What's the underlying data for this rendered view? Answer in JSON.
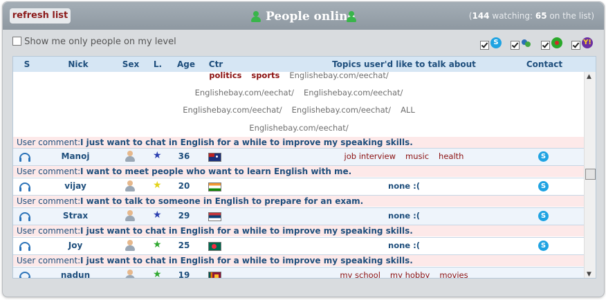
{
  "header": {
    "refresh_label": "refresh list",
    "title": "People online",
    "watching_open": "(",
    "watching_count": "144",
    "watching_label": "watching:",
    "on_list_count": "65",
    "on_list_label": "on the list)"
  },
  "options": {
    "level_filter_label": "Show me only people on my level",
    "level_filter_checked": false
  },
  "filters": [
    {
      "name": "skype",
      "checked": true,
      "icon": "skype-icon"
    },
    {
      "name": "msn",
      "checked": true,
      "icon": "msn-icon"
    },
    {
      "name": "icq",
      "checked": true,
      "icon": "icq-icon"
    },
    {
      "name": "yahoo",
      "checked": true,
      "icon": "yahoo-icon"
    }
  ],
  "columns": {
    "s": "S",
    "nick": "Nick",
    "sex": "Sex",
    "level": "L.",
    "age": "Age",
    "country": "Ctr",
    "topics": "Topics user'd like to talk about",
    "contact": "Contact"
  },
  "partial_row": {
    "topics_line1_red1": "politics",
    "topics_line1_red2": "sports",
    "topics_line1_grey": "Englishebay.com/eechat/",
    "line2_a": "Englishebay.com/eechat/",
    "line2_b": "Englishebay.com/eechat/",
    "line3_a": "Englishebay.com/eechat/",
    "line3_b": "Englishebay.com/eechat/",
    "line3_c": "ALL",
    "line4": "Englishebay.com/eechat/",
    "comment_label": "User comment:",
    "comment": "I just want to chat in English for a while to improve my speaking skills."
  },
  "users": [
    {
      "nick": "Manoj",
      "age": "36",
      "star_color": "#2b3fb0",
      "flag": "australia",
      "topics": [
        "job interview",
        "music",
        "health"
      ],
      "comment_label": "User comment:",
      "comment": "I want to meet people who want to learn English with me."
    },
    {
      "nick": "vijay",
      "age": "20",
      "star_color": "#e3d31a",
      "flag": "india",
      "topics_none": "none :(",
      "comment_label": "User comment:",
      "comment": "I want to talk to someone in English to prepare for an exam."
    },
    {
      "nick": "Strax",
      "age": "29",
      "star_color": "#2b3fb0",
      "flag": "serbia",
      "topics_none": "none :(",
      "comment_label": "User comment:",
      "comment": "I just want to chat in English for a while to improve my speaking skills."
    },
    {
      "nick": "Joy",
      "age": "25",
      "star_color": "#2fa82f",
      "flag": "bangladesh",
      "topics_none": "none :(",
      "comment_label": "User comment:",
      "comment": "I just want to chat in English for a while to improve my speaking skills."
    },
    {
      "nick": "nadun",
      "age": "19",
      "star_color": "#2fa82f",
      "flag": "sri-lanka",
      "topics": [
        "my school",
        "my hobby",
        "movies"
      ]
    }
  ]
}
